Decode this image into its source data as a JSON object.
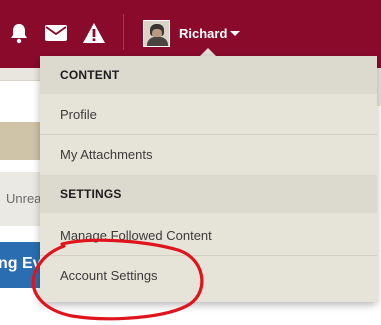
{
  "header": {
    "user_name": "Richard"
  },
  "background_page": {
    "unread_fragment": "Unrea",
    "button_fragment": "ng Ev"
  },
  "user_menu": {
    "sections": [
      {
        "title": "CONTENT",
        "items": [
          "Profile",
          "My Attachments"
        ]
      },
      {
        "title": "SETTINGS",
        "items": [
          "Manage Followed Content",
          "Account Settings"
        ]
      }
    ]
  },
  "colors": {
    "header_bg": "#8a0a2c",
    "menu_bg": "#e6e3d8",
    "menu_header_bg": "#dcd9cf",
    "annotation": "#e0141c",
    "page_button": "#2a6db0"
  },
  "icons": [
    "bell-icon",
    "mail-icon",
    "alert-icon",
    "chevron-down-icon"
  ],
  "annotation": "red circle around Account Settings"
}
